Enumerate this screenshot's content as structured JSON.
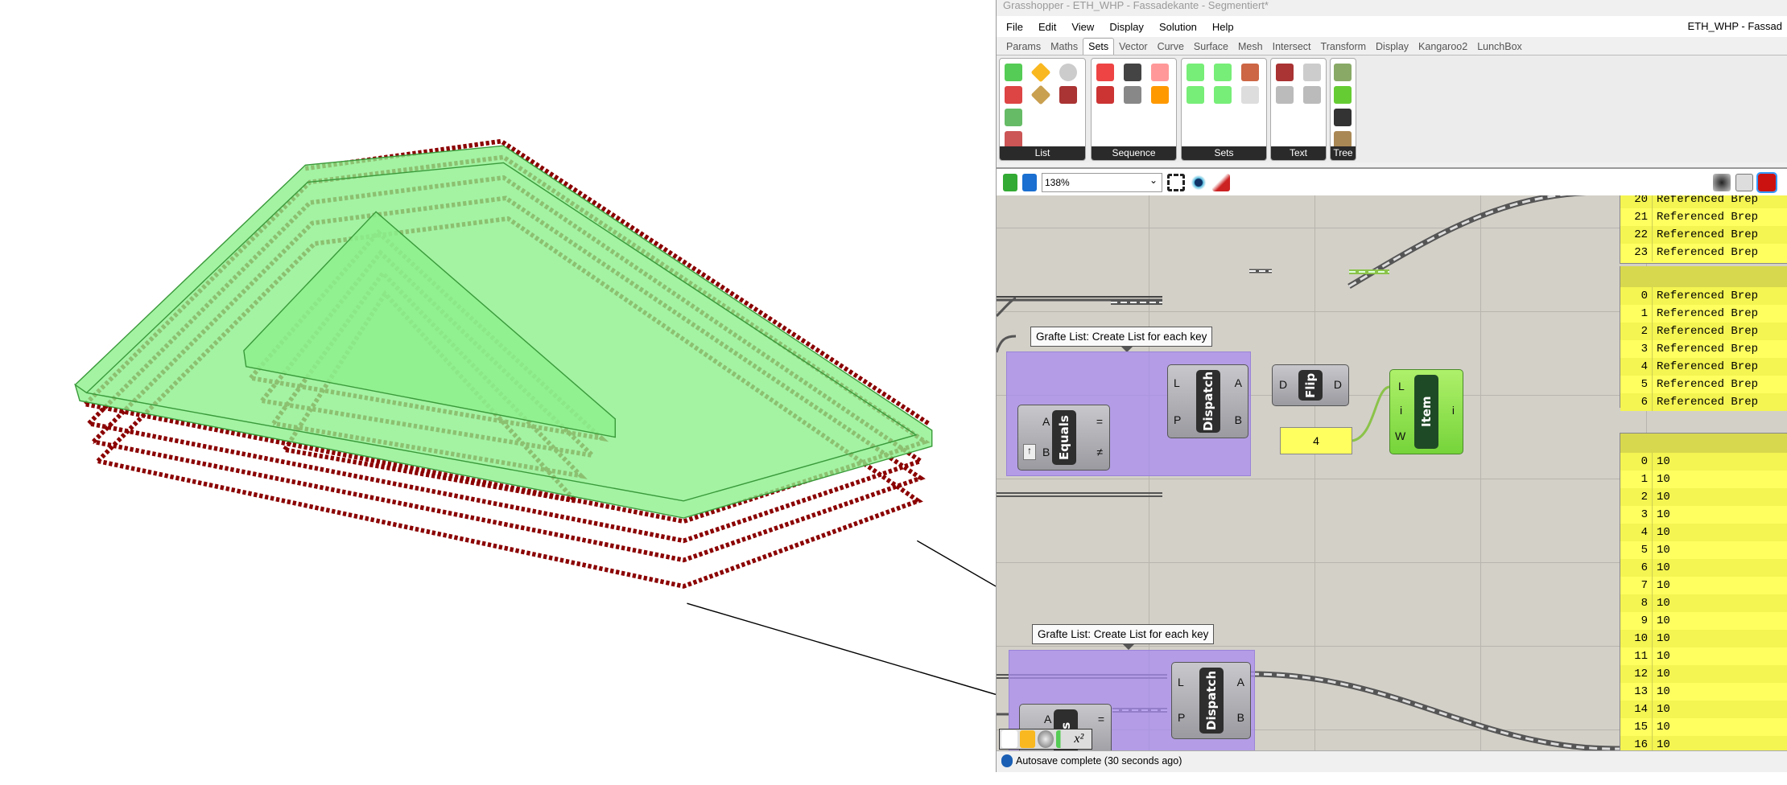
{
  "window": {
    "title": "Grasshopper - ETH_WHP - Fassadekante - Segmentiert*",
    "doc_name": "ETH_WHP - Fassad"
  },
  "menu": [
    "File",
    "Edit",
    "View",
    "Display",
    "Solution",
    "Help"
  ],
  "tabs": [
    "Params",
    "Maths",
    "Sets",
    "Vector",
    "Curve",
    "Surface",
    "Mesh",
    "Intersect",
    "Transform",
    "Display",
    "Kangaroo2",
    "LunchBox"
  ],
  "active_tab": "Sets",
  "ribbon": {
    "groups": [
      "List",
      "Sequence",
      "Sets",
      "Text",
      "Tree"
    ]
  },
  "toolbar": {
    "zoom": "138%"
  },
  "canvas": {
    "group_label": "Grafte List: Create List for each key",
    "dispatch": {
      "name": "Dispatch",
      "inputs": [
        "L",
        "P"
      ],
      "outputs": [
        "A",
        "B"
      ]
    },
    "equals": {
      "name": "Equals",
      "inputs": [
        "A",
        "B"
      ],
      "outputs": [
        "=",
        "≠"
      ]
    },
    "flip": {
      "name": "Flip",
      "inputs": [
        "D"
      ],
      "outputs": [
        "D"
      ]
    },
    "item": {
      "name": "Item",
      "inputs": [
        "L",
        "i",
        "W"
      ],
      "outputs": [
        "i"
      ]
    },
    "number_panel": "4",
    "equals2_fragment": "als",
    "brep_panel": {
      "rows_top": [
        {
          "i": "20",
          "v": "Referenced Brep"
        },
        {
          "i": "21",
          "v": "Referenced Brep"
        },
        {
          "i": "22",
          "v": "Referenced Brep"
        },
        {
          "i": "23",
          "v": "Referenced Brep"
        }
      ],
      "rows": [
        {
          "i": "0",
          "v": "Referenced Brep"
        },
        {
          "i": "1",
          "v": "Referenced Brep"
        },
        {
          "i": "2",
          "v": "Referenced Brep"
        },
        {
          "i": "3",
          "v": "Referenced Brep"
        },
        {
          "i": "4",
          "v": "Referenced Brep"
        },
        {
          "i": "5",
          "v": "Referenced Brep"
        },
        {
          "i": "6",
          "v": "Referenced Brep"
        }
      ]
    },
    "count_panel": {
      "rows": [
        {
          "i": "0",
          "v": "10"
        },
        {
          "i": "1",
          "v": "10"
        },
        {
          "i": "2",
          "v": "10"
        },
        {
          "i": "3",
          "v": "10"
        },
        {
          "i": "4",
          "v": "10"
        },
        {
          "i": "5",
          "v": "10"
        },
        {
          "i": "6",
          "v": "10"
        },
        {
          "i": "7",
          "v": "10"
        },
        {
          "i": "8",
          "v": "10"
        },
        {
          "i": "9",
          "v": "10"
        },
        {
          "i": "10",
          "v": "10"
        },
        {
          "i": "11",
          "v": "10"
        },
        {
          "i": "12",
          "v": "10"
        },
        {
          "i": "13",
          "v": "10"
        },
        {
          "i": "14",
          "v": "10"
        },
        {
          "i": "15",
          "v": "10"
        },
        {
          "i": "16",
          "v": "10"
        }
      ]
    }
  },
  "status": {
    "text": "Autosave complete (30 seconds ago)"
  },
  "colors": {
    "points": "#8b0000",
    "breps": "#7ce87c",
    "group": "#aa8cf0",
    "panel": "#ffff60",
    "item_component": "#8be84a"
  }
}
